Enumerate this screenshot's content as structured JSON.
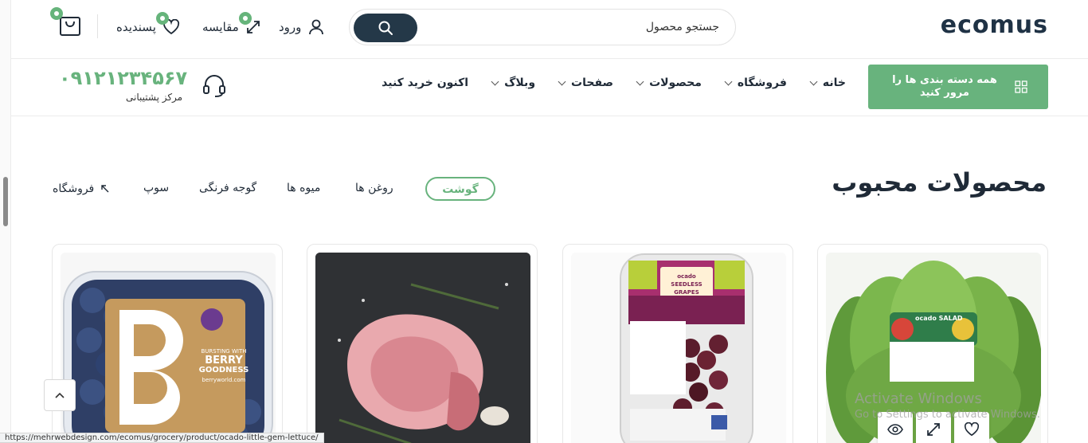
{
  "header": {
    "logo": "ecomus",
    "search_placeholder": "جستجو محصول",
    "login_label": "ورود",
    "compare_label": "مقایسه",
    "wishlist_label": "پسندیده"
  },
  "nav": {
    "categories_button": "همه دسته بندی ها را مرور کنید",
    "links": [
      "خانه",
      "فروشگاه",
      "محصولات",
      "صفحات",
      "وبلاگ",
      "اکنون خرید کنید"
    ],
    "support_phone": "۰۹۱۲۱۲۳۴۵۶۷",
    "support_label": "مرکز پشتیبانی"
  },
  "section": {
    "title": "محصولات محبوب",
    "tabs": [
      "گوشت",
      "روغن ها",
      "میوه ها",
      "گوجه فرنگی",
      "سوپ",
      "فروشگاه"
    ],
    "active_tab": "گوشت"
  },
  "products": {
    "card1_label": "ocado SALAD",
    "card2_label_line1": "ocado",
    "card2_label_line2": "SEEDLESS GRAPES",
    "card4_text_line1": "BURSTING WITH",
    "card4_text_line2": "BERRY",
    "card4_text_line3": "GOODNESS",
    "card4_text_line4": "berryworld.com",
    "card4_letter": "B"
  },
  "system": {
    "watermark_title": "Activate Windows",
    "watermark_sub": "Go to Settings to activate Windows.",
    "status_url": "https://mehrwebdesign.com/ecomus/grocery/product/ocado-little-gem-lettuce/"
  },
  "colors": {
    "accent": "#68b37d",
    "dark": "#243848"
  }
}
